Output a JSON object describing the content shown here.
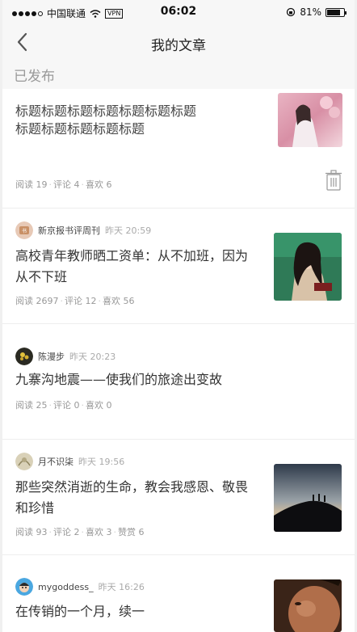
{
  "status_bar": {
    "carrier": "中国联通",
    "vpn": "VPN",
    "time": "06:02",
    "battery": "81%",
    "battery_level": 0.81
  },
  "nav": {
    "title": "我的文章"
  },
  "section": {
    "title": "已发布"
  },
  "my_article": {
    "title": "标题标题标题标题标题标题标题标题标题标题标题标题",
    "title_line1": "标题标题标题标题标题标题标题",
    "title_line2": "标题标题标题标题标题",
    "meta": {
      "read": "阅读 19",
      "comment": "评论 4",
      "like": "喜欢 6"
    }
  },
  "articles": [
    {
      "author": "新京报书评周刊",
      "time": "昨天 20:59",
      "title_line1": "高校青年教师晒工资单：从不加班，因为",
      "title_line2": "从不下班",
      "meta": {
        "read": "阅读 2697",
        "comment": "评论 12",
        "like": "喜欢 56"
      }
    },
    {
      "author": "陈漫步",
      "time": "昨天 20:23",
      "title_line1": "九寨沟地震——使我们的旅途出变故",
      "meta": {
        "read": "阅读 25",
        "comment": "评论 0",
        "like": "喜欢 0"
      }
    },
    {
      "author": "月不识柒",
      "time": "昨天 19:56",
      "title_line1": "那些突然消逝的生命，教会我感恩、敬畏",
      "title_line2": "和珍惜",
      "meta": {
        "read": "阅读 93",
        "comment": "评论 2",
        "like": "喜欢 3",
        "reward": "赞赏 6"
      }
    },
    {
      "author": "mygoddess_",
      "time": "昨天 16:26",
      "title_line1": "在传销的一个月，续一"
    }
  ]
}
